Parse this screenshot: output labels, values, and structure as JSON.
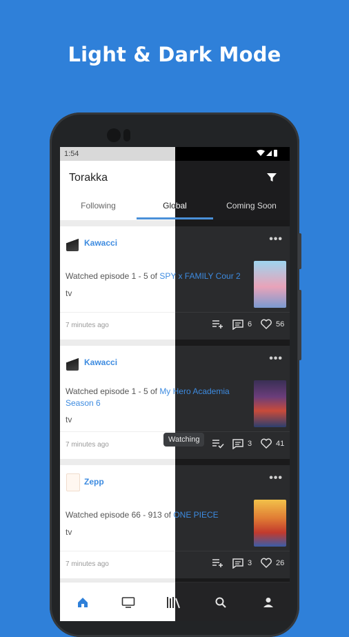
{
  "headline": "Light & Dark Mode",
  "status": {
    "time": "1:54",
    "icons": "▾◢▮"
  },
  "app": {
    "title": "Torakka"
  },
  "tabs": [
    {
      "label": "Following"
    },
    {
      "label": "Global"
    },
    {
      "label": "Coming Soon"
    }
  ],
  "active_tab": "Global",
  "feed": [
    {
      "username": "Kawacci",
      "prefix": "Watched episode 1 - 5 of ",
      "title": "SPY x FAMILY Cour 2",
      "kind": "tv",
      "time_ago": "7 minutes ago",
      "comments": "6",
      "likes": "56",
      "poster_colors": [
        "#7fc6e8",
        "#f2a9c0"
      ]
    },
    {
      "username": "Kawacci",
      "prefix": "Watched episode 1 - 5 of ",
      "title": "My Hero Academia Season 6",
      "kind": "tv",
      "time_ago": "7 minutes ago",
      "comments": "3",
      "likes": "41",
      "poster_colors": [
        "#3b3152",
        "#c94b3a"
      ]
    },
    {
      "username": "Zepp",
      "prefix": "Watched episode 66 - 913 of ",
      "title": "ONE PIECE",
      "kind": "tv",
      "time_ago": "7 minutes ago",
      "comments": "3",
      "likes": "26",
      "poster_colors": [
        "#f0b43a",
        "#d23a2e"
      ]
    }
  ],
  "watching_tooltip": "Watching",
  "bottom_nav": [
    "home-icon",
    "tv-icon",
    "library-icon",
    "search-icon",
    "profile-icon"
  ],
  "colors": {
    "accent": "#4a90d9",
    "background": "#2f80d9",
    "link": "#3d8be0"
  }
}
